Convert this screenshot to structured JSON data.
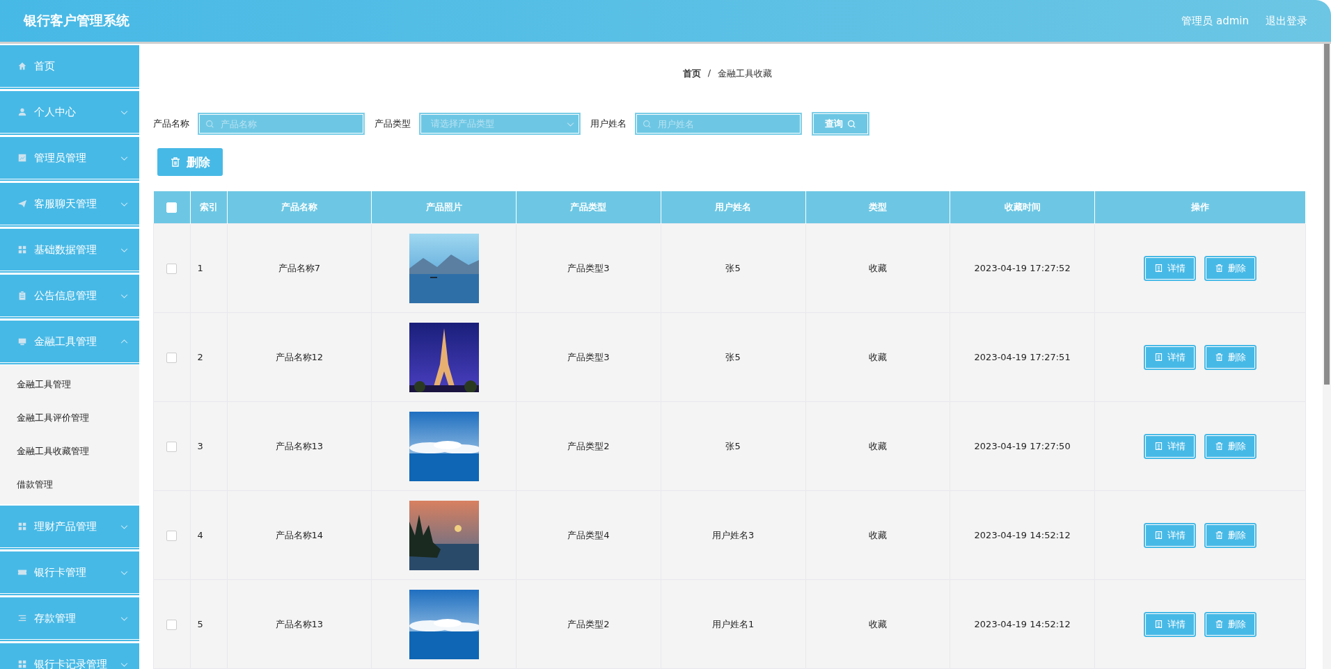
{
  "header": {
    "title": "银行客户管理系统",
    "user": "管理员 admin",
    "logout": "退出登录"
  },
  "sidebar": {
    "items": [
      {
        "label": "首页",
        "kind": "home",
        "expanded": false,
        "has_arrow": false
      },
      {
        "label": "个人中心",
        "kind": "user",
        "expanded": false,
        "has_arrow": true
      },
      {
        "label": "管理员管理",
        "kind": "chart",
        "expanded": false,
        "has_arrow": true
      },
      {
        "label": "客服聊天管理",
        "kind": "send",
        "expanded": false,
        "has_arrow": true
      },
      {
        "label": "基础数据管理",
        "kind": "grid",
        "expanded": false,
        "has_arrow": true
      },
      {
        "label": "公告信息管理",
        "kind": "clipboard",
        "expanded": false,
        "has_arrow": true
      },
      {
        "label": "金融工具管理",
        "kind": "tray",
        "expanded": true,
        "has_arrow": true,
        "children": [
          {
            "label": "金融工具管理"
          },
          {
            "label": "金融工具评价管理"
          },
          {
            "label": "金融工具收藏管理"
          },
          {
            "label": "借款管理"
          }
        ]
      },
      {
        "label": "理财产品管理",
        "kind": "grid",
        "expanded": false,
        "has_arrow": true
      },
      {
        "label": "银行卡管理",
        "kind": "ticket",
        "expanded": false,
        "has_arrow": true
      },
      {
        "label": "存款管理",
        "kind": "list",
        "expanded": false,
        "has_arrow": true
      },
      {
        "label": "银行卡记录管理",
        "kind": "grid",
        "expanded": false,
        "has_arrow": true
      }
    ]
  },
  "breadcrumb": {
    "items": [
      "首页",
      "金融工具收藏"
    ],
    "separator": "/"
  },
  "filters": [
    {
      "kind": "text",
      "label": "产品名称",
      "placeholder": "产品名称"
    },
    {
      "kind": "select",
      "label": "产品类型",
      "placeholder": "请选择产品类型"
    },
    {
      "kind": "text",
      "label": "用户姓名",
      "placeholder": "用户姓名"
    }
  ],
  "search_button": "查询",
  "delete_button": "删除",
  "table": {
    "columns": [
      "索引",
      "产品名称",
      "产品照片",
      "产品类型",
      "用户姓名",
      "类型",
      "收藏时间",
      "操作"
    ],
    "select_all": false,
    "rows": [
      {
        "checked": false,
        "index": "1",
        "name": "产品名称7",
        "photo": {
          "kind": "picture"
        },
        "type": "产品类型3",
        "user": "张5",
        "category": "收藏",
        "time": "2023-04-19 17:27:52",
        "actions": [
          "详情",
          "删除"
        ]
      },
      {
        "checked": false,
        "index": "2",
        "name": "产品名称12",
        "photo": {
          "kind": "picture"
        },
        "type": "产品类型3",
        "user": "张5",
        "category": "收藏",
        "time": "2023-04-19 17:27:51",
        "actions": [
          "详情",
          "删除"
        ]
      },
      {
        "checked": false,
        "index": "3",
        "name": "产品名称13",
        "photo": {
          "kind": "picture"
        },
        "type": "产品类型2",
        "user": "张5",
        "category": "收藏",
        "time": "2023-04-19 17:27:50",
        "actions": [
          "详情",
          "删除"
        ]
      },
      {
        "checked": false,
        "index": "4",
        "name": "产品名称14",
        "photo": {
          "kind": "picture"
        },
        "type": "产品类型4",
        "user": "用户姓名3",
        "category": "收藏",
        "time": "2023-04-19 14:52:12",
        "actions": [
          "详情",
          "删除"
        ]
      },
      {
        "checked": false,
        "index": "5",
        "name": "产品名称13",
        "photo": {
          "kind": "picture"
        },
        "type": "产品类型2",
        "user": "用户姓名1",
        "category": "收藏",
        "time": "2023-04-19 14:52:12",
        "actions": [
          "详情",
          "删除"
        ]
      }
    ]
  }
}
